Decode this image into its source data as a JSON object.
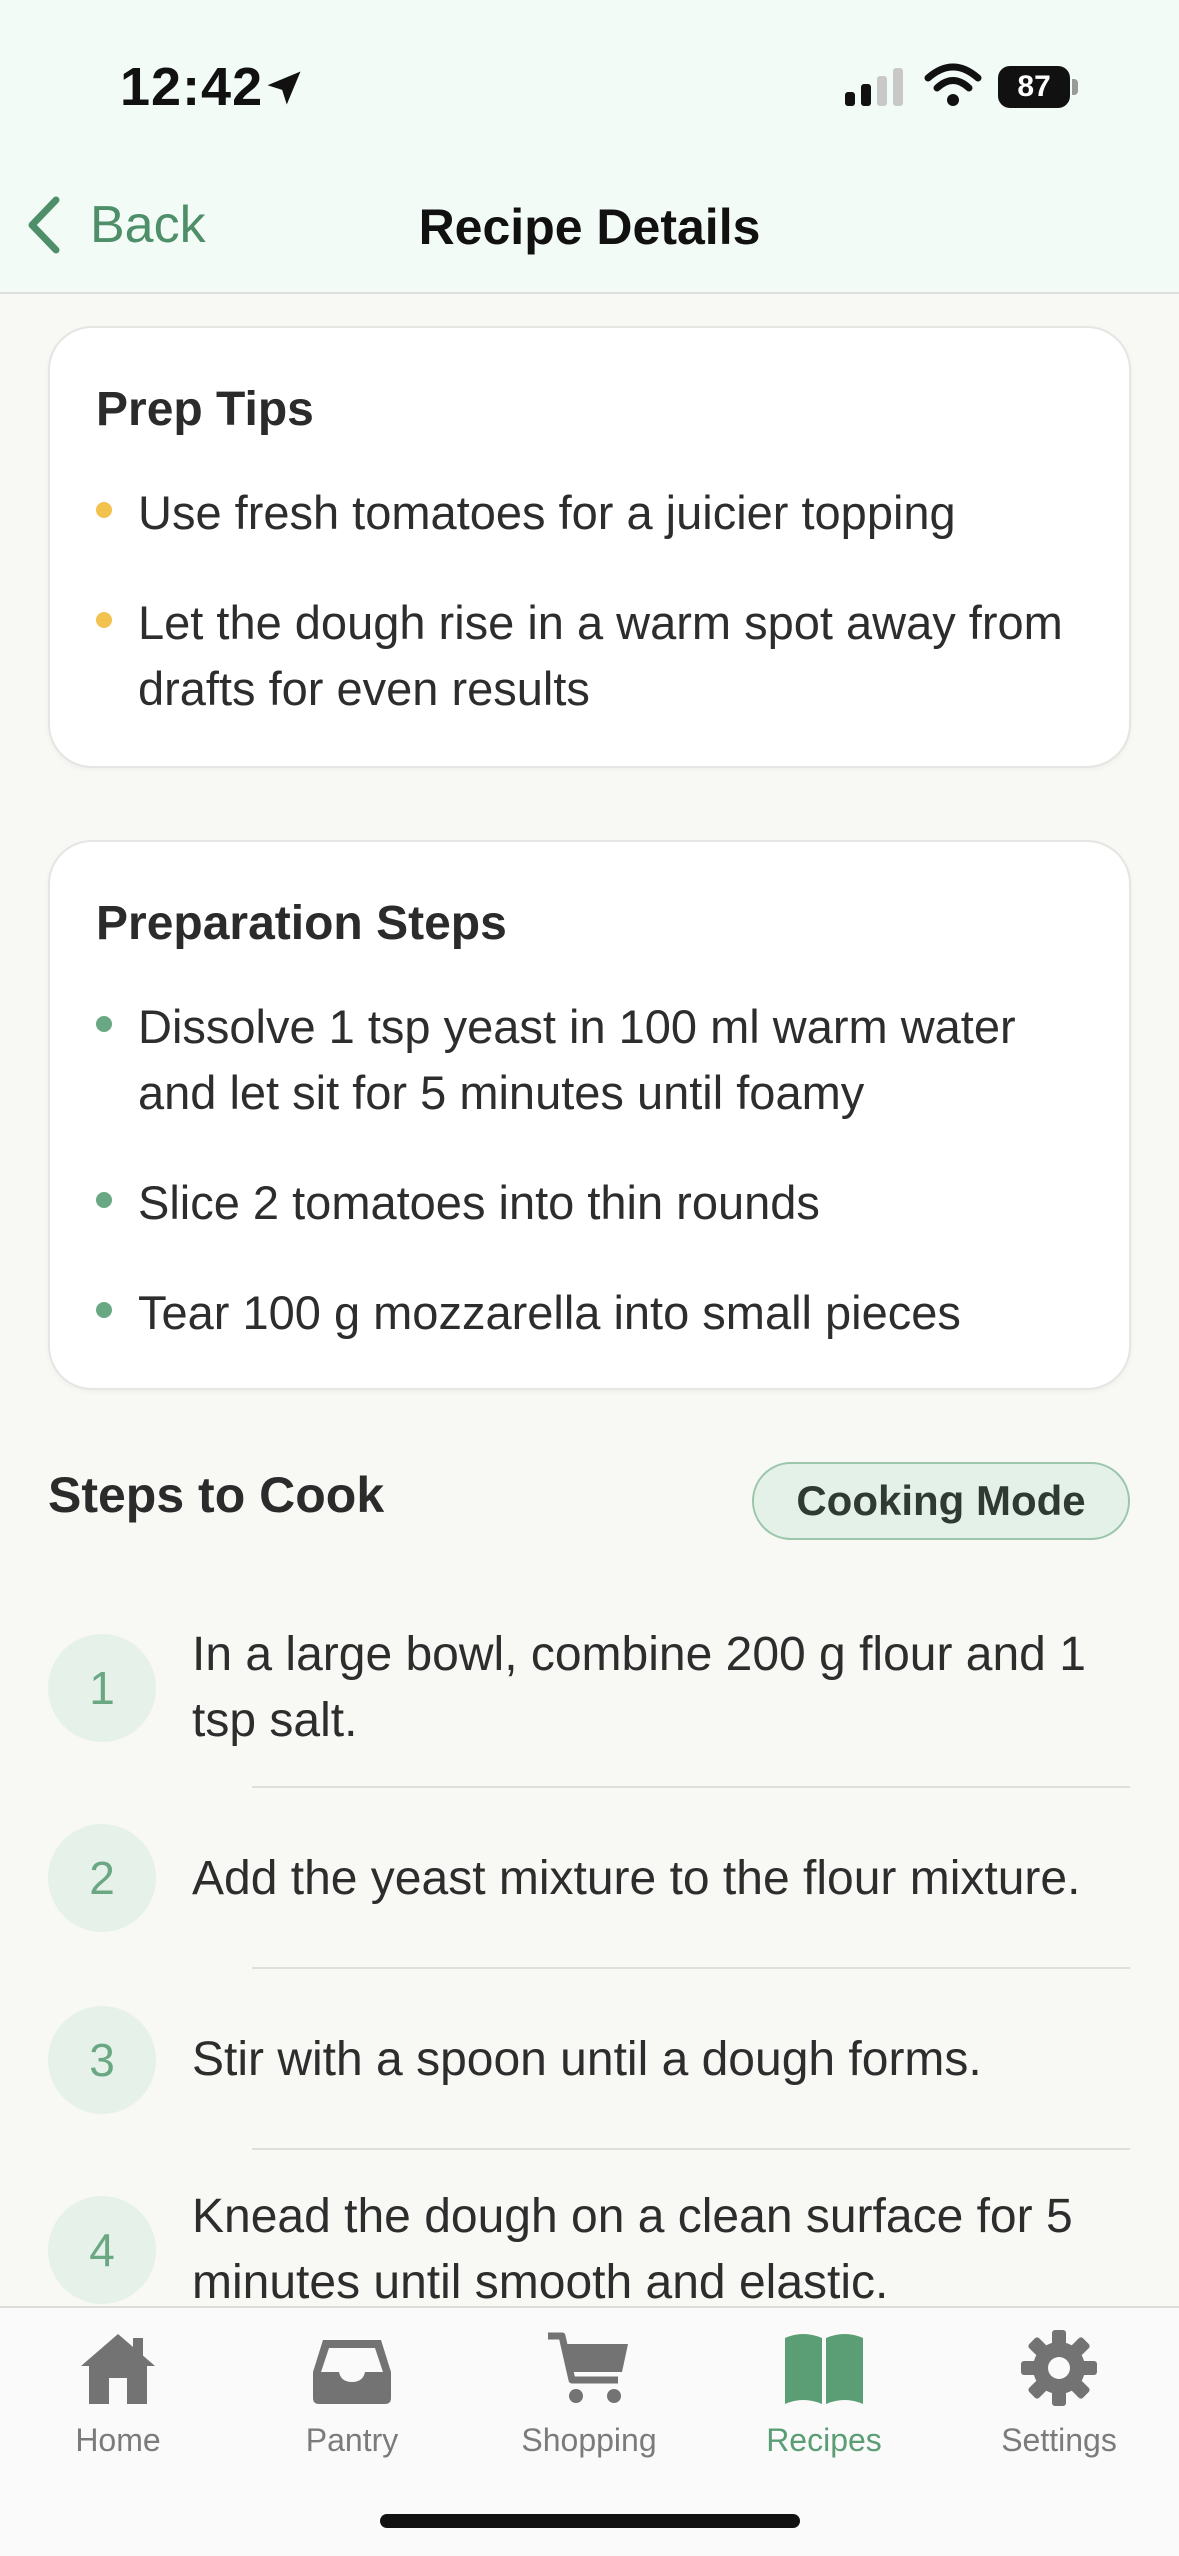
{
  "status_bar": {
    "time": "12:42",
    "battery": "87"
  },
  "nav": {
    "back_label": "Back",
    "title": "Recipe Details"
  },
  "prep_tips": {
    "title": "Prep Tips",
    "items": [
      "Use fresh tomatoes for a juicier topping",
      "Let the dough rise in a warm spot away from drafts for even results"
    ]
  },
  "preparation_steps": {
    "title": "Preparation Steps",
    "items": [
      "Dissolve 1 tsp yeast in 100 ml warm water and let sit for 5 minutes until foamy",
      "Slice 2 tomatoes into thin rounds",
      "Tear 100 g mozzarella into small pieces"
    ]
  },
  "steps_to_cook": {
    "title": "Steps to Cook",
    "cooking_mode_label": "Cooking Mode",
    "steps": [
      {
        "number": "1",
        "text": "In a large bowl, combine 200 g flour and 1 tsp salt."
      },
      {
        "number": "2",
        "text": "Add the yeast mixture to the flour mixture."
      },
      {
        "number": "3",
        "text": "Stir with a spoon until a dough forms."
      },
      {
        "number": "4",
        "text": "Knead the dough on a clean surface for 5 minutes until smooth and elastic."
      }
    ]
  },
  "tabbar": {
    "tabs": [
      {
        "label": "Home",
        "icon": "home-icon"
      },
      {
        "label": "Pantry",
        "icon": "pantry-icon"
      },
      {
        "label": "Shopping",
        "icon": "cart-icon"
      },
      {
        "label": "Recipes",
        "icon": "book-icon",
        "active": true
      },
      {
        "label": "Settings",
        "icon": "gear-icon"
      }
    ]
  },
  "colors": {
    "accent": "#5b9e76",
    "tip_dot": "#f2c14e",
    "step_dot": "#6aa883",
    "header_bg": "#f3fbf7"
  }
}
